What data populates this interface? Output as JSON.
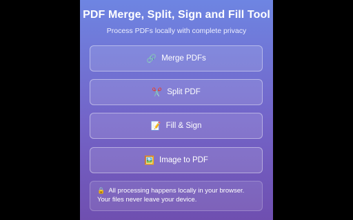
{
  "header": {
    "title": "PDF Merge, Split, Sign and Fill Tool",
    "subtitle": "Process PDFs locally with complete privacy"
  },
  "actions": [
    {
      "icon": "link-icon",
      "glyph": "🔗",
      "label": "Merge PDFs"
    },
    {
      "icon": "scissors-icon",
      "glyph": "✂️",
      "label": "Split PDF"
    },
    {
      "icon": "memo-icon",
      "glyph": "📝",
      "label": "Fill & Sign"
    },
    {
      "icon": "image-icon",
      "glyph": "🖼️",
      "label": "Image to PDF"
    }
  ],
  "notice": {
    "icon": "lock-icon",
    "glyph": "🔒",
    "line1": "All processing happens locally in your browser.",
    "line2": "Your files never leave your device."
  },
  "colors": {
    "background": "#000000",
    "panel_gradient_top": "#6e85e2",
    "panel_gradient_bottom": "#6f4fb0",
    "text": "#ffffff"
  }
}
